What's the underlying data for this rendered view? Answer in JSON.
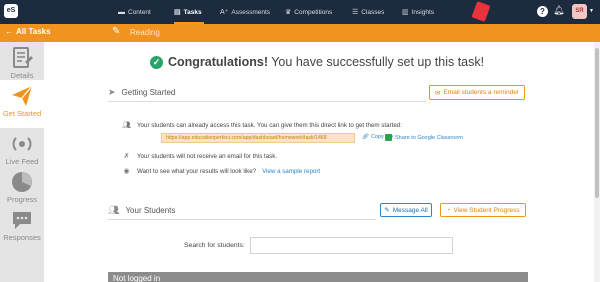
{
  "nav": {
    "logo": "eS",
    "items": [
      {
        "label": "Content",
        "icon": "folder-icon"
      },
      {
        "label": "Tasks",
        "icon": "tasks-icon"
      },
      {
        "label": "Assessments",
        "icon": "assessment-icon"
      },
      {
        "label": "Competitions",
        "icon": "trophy-icon"
      },
      {
        "label": "Classes",
        "icon": "classes-icon"
      },
      {
        "label": "Insights",
        "icon": "chart-icon"
      }
    ],
    "active": "Tasks",
    "help": "?",
    "avatar": "SR"
  },
  "taskbar": {
    "back_label": "All Tasks",
    "task_name": "Reading"
  },
  "sidebar": {
    "items": [
      {
        "label": "Details",
        "icon": "details-icon"
      },
      {
        "label": "Get Started",
        "icon": "paper-plane-icon"
      },
      {
        "label": "Live Feed",
        "icon": "live-feed-icon"
      },
      {
        "label": "Progress",
        "icon": "pie-chart-icon"
      },
      {
        "label": "Responses",
        "icon": "chat-bubble-icon"
      }
    ],
    "active": "Get Started"
  },
  "main": {
    "headline_bold": "Congratulations!",
    "headline_rest": " You have successfully set up this task!",
    "getting_started": {
      "title": "Getting Started",
      "reminder_button": "Email students a reminder",
      "access_text": "Your students can already access this task. You can give them this direct link to get them started:",
      "direct_link": "https://app.educationperfect.com/app/dashboard/homework/task/1468",
      "copy_link": "Copy link",
      "share_gc": "Share to Google Classroom",
      "no_email_text": "Your students will not receive an email for this task.",
      "results_text": "Want to see what your results will look like?",
      "sample_report": "View a sample report"
    },
    "your_students": {
      "title": "Your Students",
      "message_all": "Message All",
      "view_progress": "View Student Progress",
      "search_label": "Search for students:",
      "search_value": "",
      "not_logged_in": "Not logged in"
    }
  },
  "colors": {
    "nav_bg": "#1c2b3e",
    "accent_orange": "#f0941f",
    "link_blue": "#2c86c8",
    "success_green": "#29a36a"
  }
}
